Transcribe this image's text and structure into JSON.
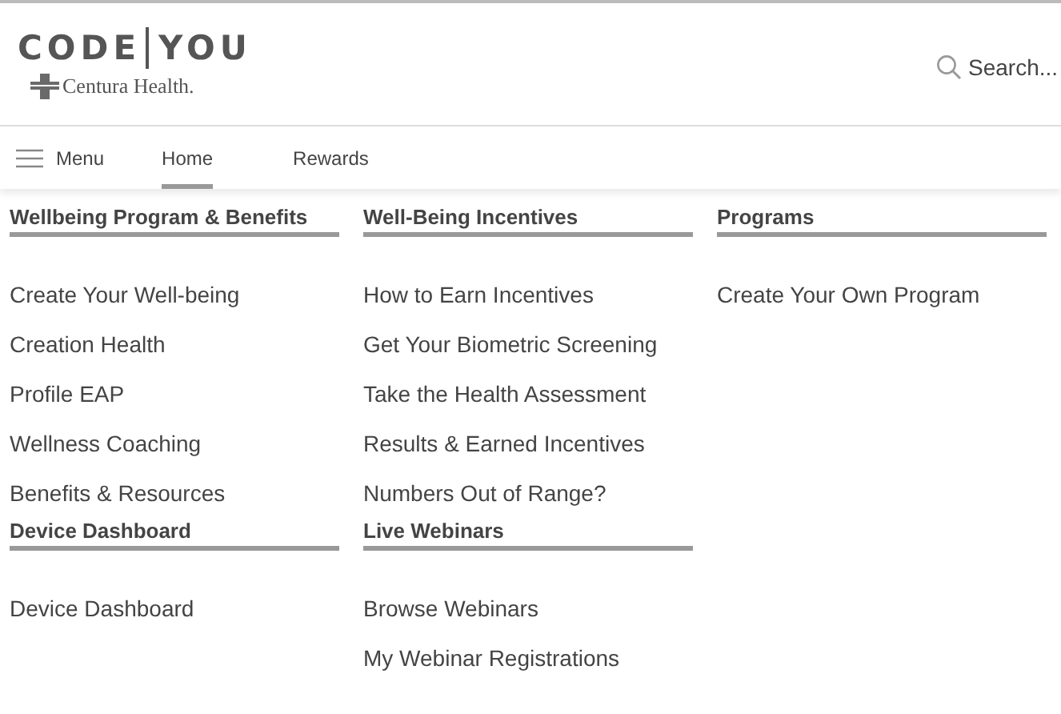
{
  "logo": {
    "left": "CODE",
    "right": "YOU",
    "subtitle": "Centura Health."
  },
  "search": {
    "placeholder": "Search..."
  },
  "nav": [
    {
      "kind": "menu",
      "label": "Menu",
      "selected": false
    },
    {
      "kind": "tab",
      "label": "Home",
      "selected": true
    },
    {
      "kind": "tab",
      "label": "Rewards",
      "selected": false
    }
  ],
  "sections": [
    {
      "title": "Wellbeing Program & Benefits",
      "links": [
        "Create Your Well-being",
        "Creation Health",
        "Profile EAP",
        "Wellness Coaching",
        "Benefits & Resources"
      ]
    },
    {
      "title": "Well-Being Incentives",
      "links": [
        "How to Earn Incentives",
        "Get Your Biometric Screening",
        "Take the Health Assessment",
        "Results & Earned Incentives",
        "Numbers Out of Range?"
      ]
    },
    {
      "title": "Programs",
      "links": [
        "Create Your Own Program"
      ]
    },
    {
      "title": "Device Dashboard",
      "links": [
        "Device Dashboard"
      ]
    },
    {
      "title": "Live Webinars",
      "links": [
        "Browse Webinars",
        "My Webinar Registrations"
      ]
    }
  ]
}
